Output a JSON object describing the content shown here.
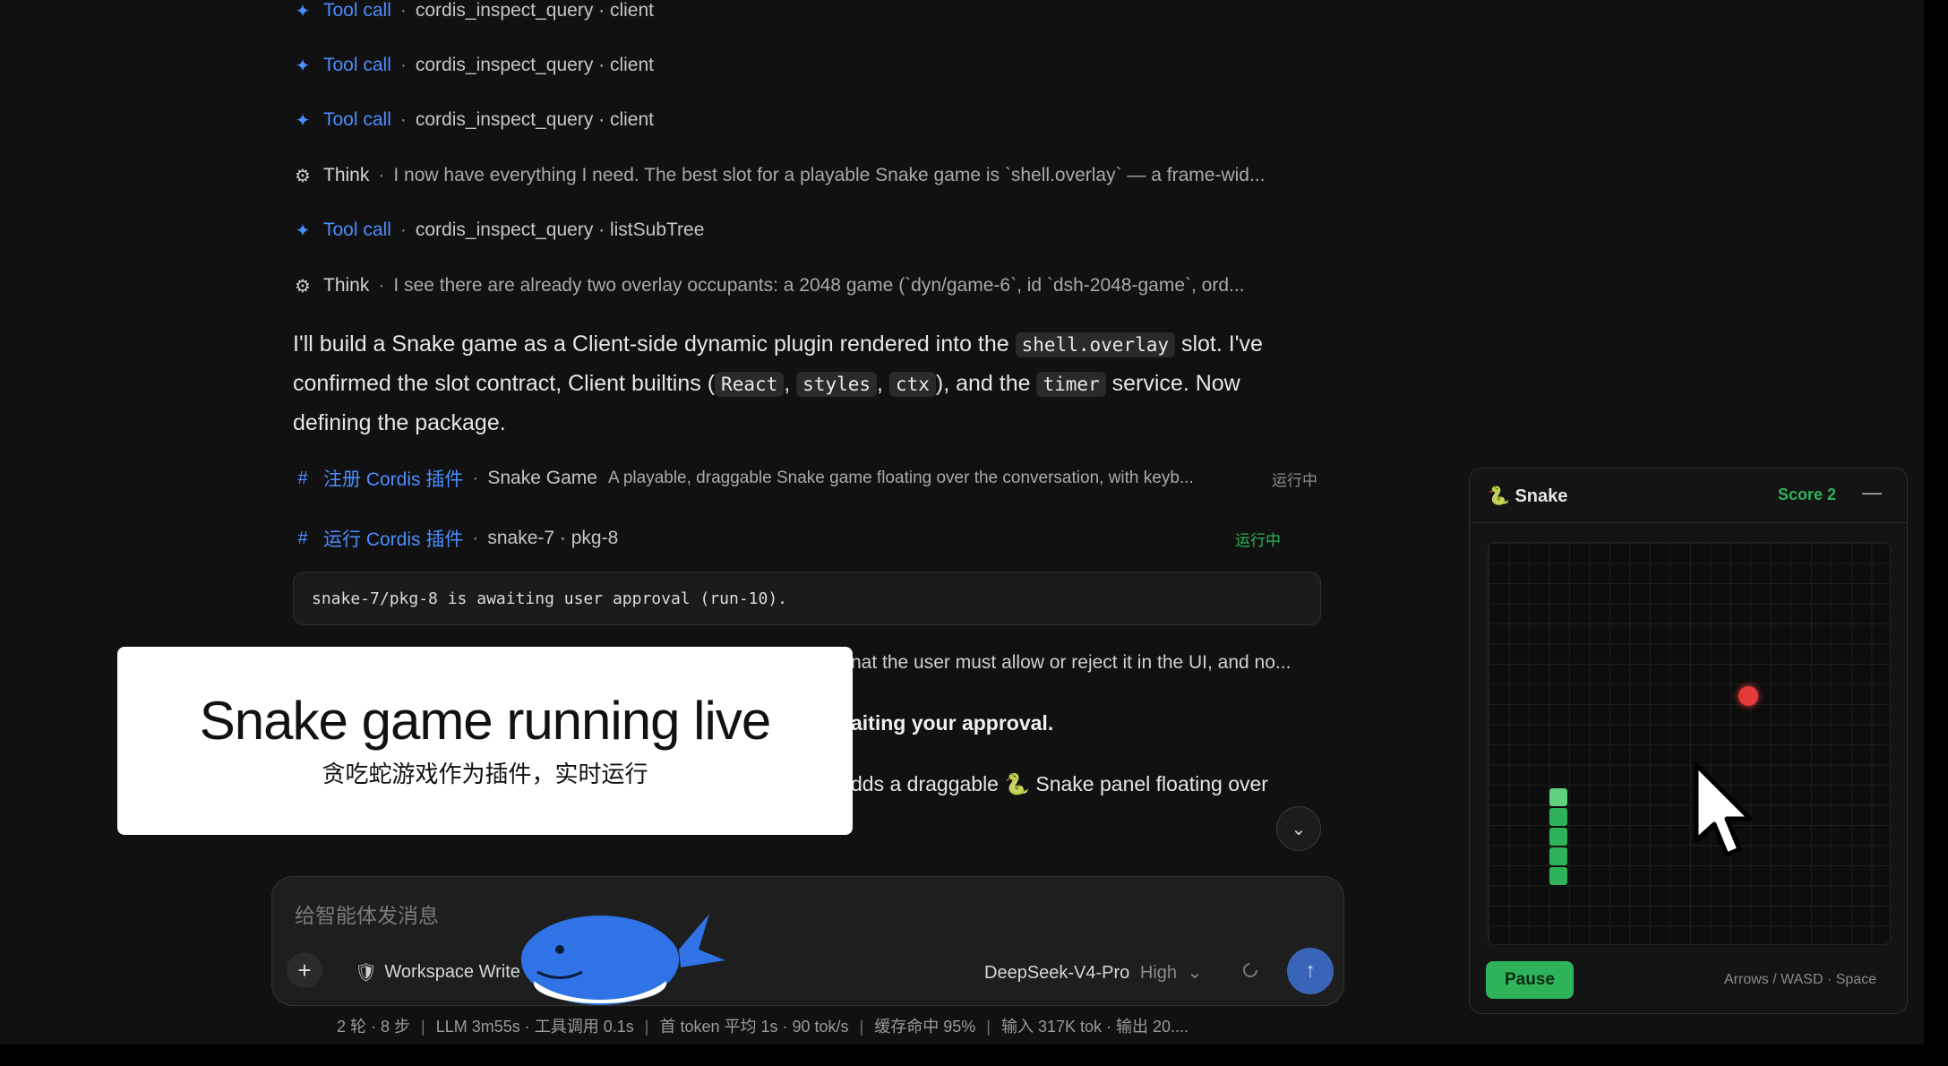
{
  "steps": [
    {
      "kind": "Tool call",
      "detail": "cordis_inspect_query · client"
    },
    {
      "kind": "Tool call",
      "detail": "cordis_inspect_query · client"
    },
    {
      "kind": "Tool call",
      "detail": "cordis_inspect_query · client"
    },
    {
      "kind": "Think",
      "detail": "I now have everything I need. The best slot for a playable Snake game is `shell.overlay` — a frame-wid..."
    },
    {
      "kind": "Tool call",
      "detail": "cordis_inspect_query · listSubTree"
    },
    {
      "kind": "Think",
      "detail": "I see there are already two overlay occupants: a 2048 game (`dyn/game-6`, id `dsh-2048-game`, ord..."
    }
  ],
  "message": {
    "p1": "I'll build a Snake game as a Client-side dynamic plugin rendered into the",
    "c1": "shell.overlay",
    "p2": "slot. I've confirmed the slot contract, Client builtins (",
    "c2": "React",
    "c3": "styles",
    "c4": "ctx",
    "p3": "), and the",
    "c5": "timer",
    "p4": "service. Now defining the package."
  },
  "register_step": {
    "kind": "注册 Cordis 插件",
    "name": "Snake Game",
    "desc": "A playable, draggable Snake game floating over the conversation, with keyb...",
    "status": "运行中"
  },
  "run_step": {
    "kind": "运行 Cordis 插件",
    "detail": "snake-7 · pkg-8",
    "status": "运行中"
  },
  "code_output": "snake-7/pkg-8 is awaiting user approval (run-10).",
  "partial_lines": {
    "l1": "nat the user must allow or reject it in the UI, and no...",
    "l2": "aiting your approval.",
    "l3": "dds a draggable 🐍 Snake panel floating over"
  },
  "caption": {
    "title": "Snake game running live",
    "subtitle": "贪吃蛇游戏作为插件，实时运行"
  },
  "composer": {
    "placeholder": "给智能体发消息",
    "workspace": "Workspace Write",
    "model": "DeepSeek-V4-Pro",
    "effort": "High"
  },
  "stats": [
    "2 轮 · 8 步",
    "LLM 3m55s · 工具调用 0.1s",
    "首 token 平均 1s · 90 tok/s",
    "缓存命中 95%",
    "输入 317K tok · 输出 20...."
  ],
  "snake_panel": {
    "title": "Snake",
    "score": "Score 2",
    "pause_label": "Pause",
    "controls": "Arrows / WASD · Space"
  },
  "colors": {
    "accent_blue": "#4c8dff",
    "status_green": "#2fb35a",
    "food_red": "#e53b3b",
    "background": "#111111"
  }
}
